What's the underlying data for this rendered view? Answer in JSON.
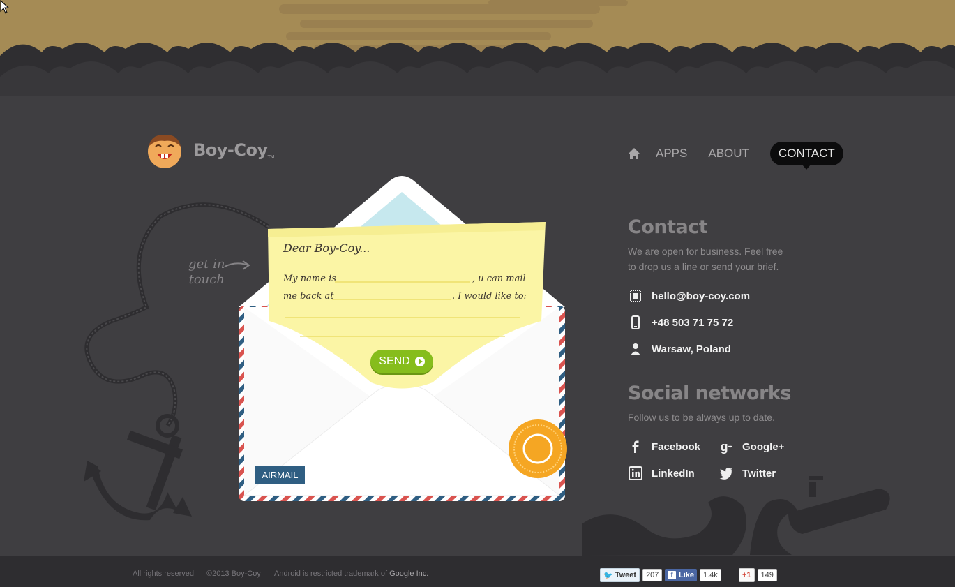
{
  "brand": {
    "name": "Boy-Coy",
    "tm": "TM"
  },
  "nav": {
    "items": [
      "APPS",
      "ABOUT",
      "CONTACT"
    ],
    "active": "CONTACT"
  },
  "getin": {
    "line1": "get in",
    "line2": "touch"
  },
  "letter": {
    "greeting": "Dear Boy-Coy...",
    "line1a": "My name is",
    "line1b": ", u can mail",
    "line2a": "me back at",
    "line2b": ". I would like to:",
    "send": "SEND",
    "airmail": "AIRMAIL"
  },
  "contact": {
    "title": "Contact",
    "desc1": "We are open for business. Feel free",
    "desc2": "to drop us a line or send your brief.",
    "email": "hello@boy-coy.com",
    "phone": "+48 503 71 75 72",
    "location": "Warsaw, Poland"
  },
  "social": {
    "title": "Social networks",
    "desc": "Follow us to be always up to date.",
    "links": [
      "Facebook",
      "Google+",
      "LinkedIn",
      "Twitter"
    ]
  },
  "footer": {
    "rights": "All rights reserved",
    "copyright": "©2013 Boy-Coy",
    "trademark": "Android is restricted trademark of",
    "google": "Google Inc."
  },
  "share": {
    "tweet_label": "Tweet",
    "tweet_count": "207",
    "like_label": "Like",
    "like_count": "1.4k",
    "plus_label": "+1",
    "plus_count": "149"
  },
  "colors": {
    "background": "#3f3e41",
    "sky": "#a58b55",
    "accent_green": "#86bd1c",
    "nav_active": "#0c0c0d"
  }
}
